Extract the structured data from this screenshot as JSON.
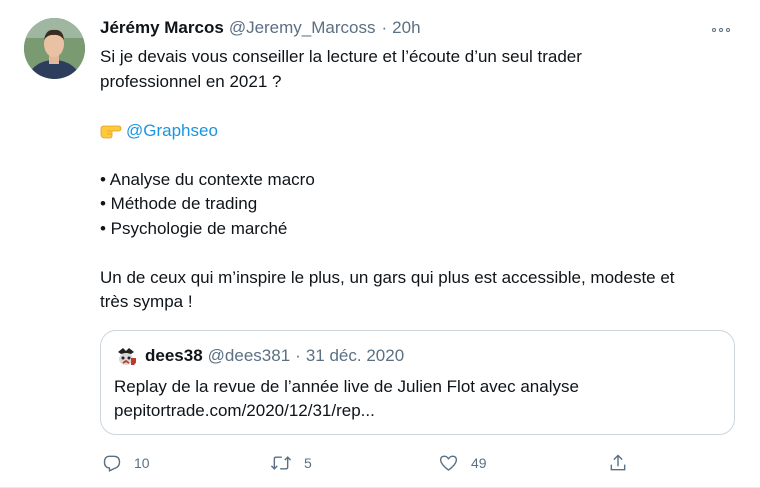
{
  "tweet": {
    "author_name": "Jérémy Marcos",
    "author_handle": "@Jeremy_Marcoss",
    "separator": "·",
    "time": "20h",
    "lines": {
      "intro_1": "Si je devais vous conseiller la lecture et l’écoute d’un seul trader",
      "intro_2": "professionnel en 2021 ?",
      "mention": "@Graphseo",
      "bullet_1": "• Analyse du contexte macro",
      "bullet_2": "• Méthode de trading",
      "bullet_3": "• Psychologie de marché",
      "outro_1": "Un de ceux qui m’inspire le plus, un gars qui plus est accessible, modeste et",
      "outro_2": "très sympa !"
    },
    "icons": {
      "more": "more-icon",
      "pointing": "backhand-index-pointing-right-icon"
    }
  },
  "quoted_tweet": {
    "author_name": "dees38",
    "author_handle": "@dees381",
    "separator": "·",
    "date": "31 déc. 2020",
    "text_1": "Replay de la revue de l’année live de Julien Flot avec analyse",
    "text_2": "pepitortrade.com/2020/12/31/rep..."
  },
  "actions": {
    "reply_count": "10",
    "retweet_count": "5",
    "like_count": "49",
    "icons": [
      "reply-icon",
      "retweet-icon",
      "like-icon",
      "share-icon"
    ]
  },
  "colors": {
    "text": "#0f1419",
    "secondary": "#5b7083",
    "link": "#1b95e0",
    "border": "#ccd6dd"
  }
}
